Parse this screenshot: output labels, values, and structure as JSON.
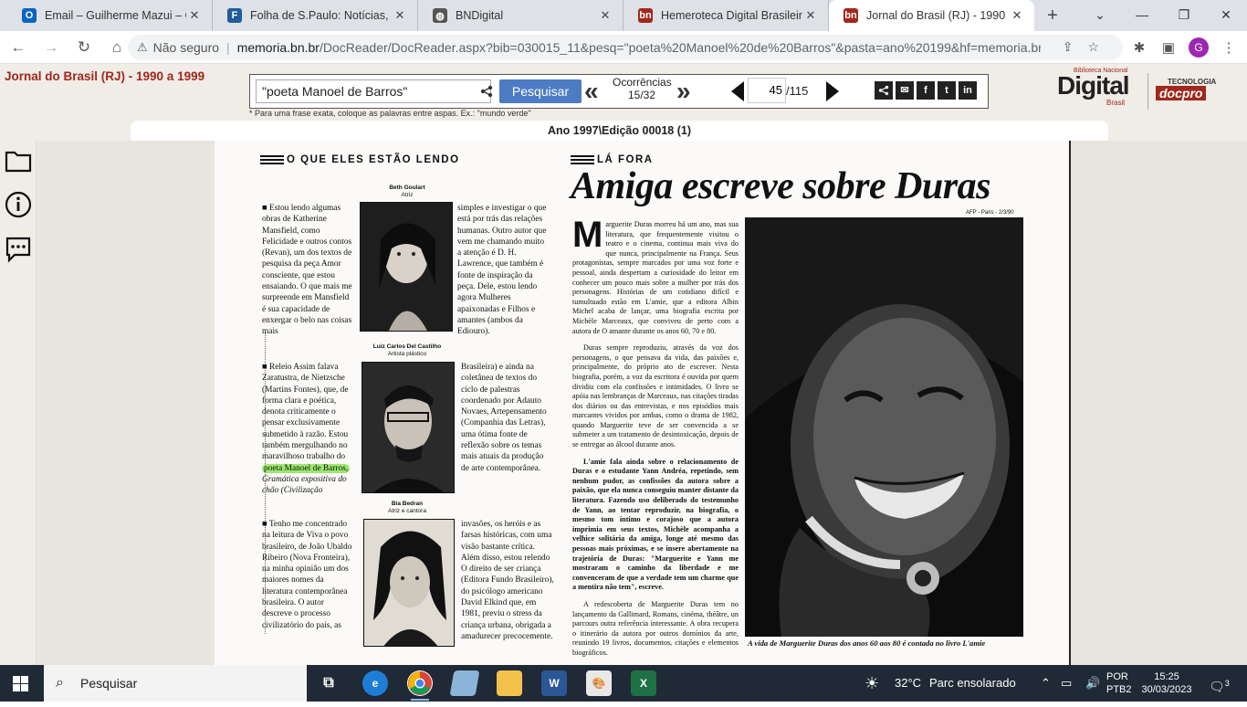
{
  "browser": {
    "tabs": [
      {
        "title": "Email – Guilherme Mazui – O",
        "favicon": "outlook-icon",
        "color": "#0a64c2",
        "glyph": "O",
        "active": false
      },
      {
        "title": "Folha de S.Paulo: Notícias, Im",
        "favicon": "folha-icon",
        "color": "#1f5c99",
        "glyph": "F",
        "active": false
      },
      {
        "title": "BNDigital",
        "favicon": "globe-icon",
        "color": "#555555",
        "glyph": "◍",
        "active": false
      },
      {
        "title": "Hemeroteca Digital Brasileira",
        "favicon": "bn-icon",
        "color": "#a0281d",
        "glyph": "bn",
        "active": false
      },
      {
        "title": "Jornal do Brasil (RJ) - 1990 a",
        "favicon": "bn-icon",
        "color": "#a0281d",
        "glyph": "bn",
        "active": true
      }
    ],
    "new_tab": "+",
    "window_controls": {
      "dropdown": "⌄",
      "minimize": "—",
      "restore": "❐",
      "close": "✕"
    },
    "address": {
      "security": "Não seguro",
      "host": "memoria.bn.br",
      "path": "/DocReader/DocReader.aspx?bib=030015_11&pesq=\"poeta%20Manoel%20de%20Barros\"&pasta=ano%20199&hf=memoria.bn...."
    },
    "avatar_letter": "G"
  },
  "site": {
    "collection_title": "Jornal do Brasil (RJ) - 1990 a 1999",
    "search": {
      "value": "\"poeta Manoel de Barros\"",
      "button": "Pesquisar"
    },
    "occurrences": {
      "label": "Ocorrências",
      "value": "15/32"
    },
    "page": {
      "current": "45",
      "total": "/115"
    },
    "hint": "* Para uma frase exata, coloque as palavras entre aspas. Ex.: \"mundo verde\"",
    "edition": "Ano 1997\\Edição 00018 (1)",
    "logo": {
      "main": "Digital",
      "top": "Biblioteca Nacional",
      "sub": "Brasil",
      "tec": "TECNOLOGIA",
      "docpro": "docpro"
    },
    "social": [
      "share",
      "email",
      "f",
      "t",
      "in"
    ]
  },
  "newspaper": {
    "left_section": "O QUE ELES ESTÃO LENDO",
    "right_section": "LÁ FORA",
    "headline": "Amiga escreve sobre Duras",
    "credit": "AFP - Paris - 2/3/90",
    "people": [
      {
        "name": "Beth Goulart",
        "role": "Atriz"
      },
      {
        "name": "Luiz Carlos Del Castilho",
        "role": "Artista plástico"
      },
      {
        "name": "Bia Bedran",
        "role": "Atriz e cantora"
      }
    ],
    "block1_left": "■ Estou lendo algumas obras de Katherine Mansfield, como Felicidade e outros contos (Revan), um dos textos de pesquisa da peça Amor consciente, que estou ensaiando. O que mais me surpreende em Mansfield é sua capacidade de enxergar o belo nas coisas mais",
    "block1_right": "simples e investigar o que está por trás das relações humanas. Outro autor que vem me chamando muito a atenção é D. H. Lawrence, que também é fonte de inspiração da peça. Dele, estou lendo agora Mulheres apaixonadas e Filhos e amantes (ambos da Ediouro).",
    "block2_left_a": "■ Releio Assim falava Zaratustra, de Nietzsche (Martins Fontes), que, de forma clara e poética, denota criticamente o pensar exclusivamente submetido à razão. Estou também mergulhando no maravilhoso trabalho do",
    "block2_highlight": "poeta Manoel de Barros,",
    "block2_left_b": "Gramática expositiva do chão (Civilização",
    "block2_right": "Brasileira) e ainda na coletânea de textos do ciclo de palestras coordenado por Adauto Novaes, Artepensamento (Companhia das Letras), uma ótima fonte de reflexão sobre os temas mais atuais da produção de arte contemporânea.",
    "block3_left": "■ Tenho me concentrado na leitura de Viva o povo brasileiro, de João Ubaldo Ribeiro (Nova Fronteira), na minha opinião um dos maiores nomes da literatura contemporânea brasileira. O autor descreve o processo civilizatório do país, as",
    "block3_right": "invasões, os heróis e as farsas históricas, com uma visão bastante crítica. Além disso, estou relendo O direito de ser criança (Editora Fundo Brasileiro), do psicólogo americano David Elkind que, em 1981, previu o stress da criança urbana, obrigada a amadurecer precocemente.",
    "article_dropcap": "M",
    "article_p1": "arguerite Duras morreu há um ano, mas sua literatura, que frequentemente visitou o teatro e o cinema, continua mais viva do que nunca, principalmente na França. Seus protagonistas, sempre marcados por uma voz forte e pessoal, ainda despertam a curiosidade do leitor em conhecer um pouco mais sobre a mulher por trás dos personagens. Histórias de um cotidiano difícil e tumultuado estão em L'amie, que a editora Albin Michel acaba de lançar, uma biografia escrita por Michèle Marceaux, que conviveu de perto com a autora de O amante durante os anos 60, 70 e 80.",
    "article_p2": "Duras sempre reproduziu, através da voz dos personagens, o que pensava da vida, das paixões e, principalmente, do próprio ato de escrever. Nesta biografia, porém, a voz da escritora é ouvida por quem dividiu com ela confissões e intimidades. O livro se apóia nas lembranças de Marceaux, nas citações tiradas dos diários ou das entrevistas, e nos episódios mais marcantes vividos por ambas, como o drama de 1982, quando Marguerite teve de ser convencida a se submeter a um tratamento de desintoxicação, depois de se entregar ao álcool durante anos.",
    "article_p3": "L'amie fala ainda sobre o relacionamento de Duras e o estudante Yann Andréa, repetindo, sem nenhum pudor, as confissões da autora sobre a paixão, que ela nunca conseguiu manter distante da literatura. Fazendo uso deliberado do testemunho de Yann, ao tentar reproduzir, na biografia, o mesmo tom íntimo e corajoso que a autora imprimia em seus textos, Michèle acompanha a velhice solitária da amiga, longe até mesmo das pessoas mais próximas, e se insere abertamente na trajetória de Duras: \"Marguerite e Yann me mostraram o caminho da liberdade e me convenceram de que a verdade tem um charme que a mentira não tem\", escreve.",
    "article_p4": "A redescoberta de Marguerite Duras tem no lançamento da Gallimard, Romans, cinéma, théâtre, un parcours outra referência interessante. A obra recupera o itinerário da autora por outros domínios da arte, reunindo 19 livros, documentos, citações e elementos biográficos.",
    "photo_caption": "A vida de Marguerite Duras dos anos 60 aos 80 é contada no livro L'amie"
  },
  "taskbar": {
    "search": "Pesquisar",
    "weather": {
      "temp": "32°C",
      "desc": "Parc ensolarado"
    },
    "lang": {
      "line1": "POR",
      "line2": "PTB2"
    },
    "clock": {
      "time": "15:25",
      "date": "30/03/2023"
    },
    "notifications": "3"
  }
}
